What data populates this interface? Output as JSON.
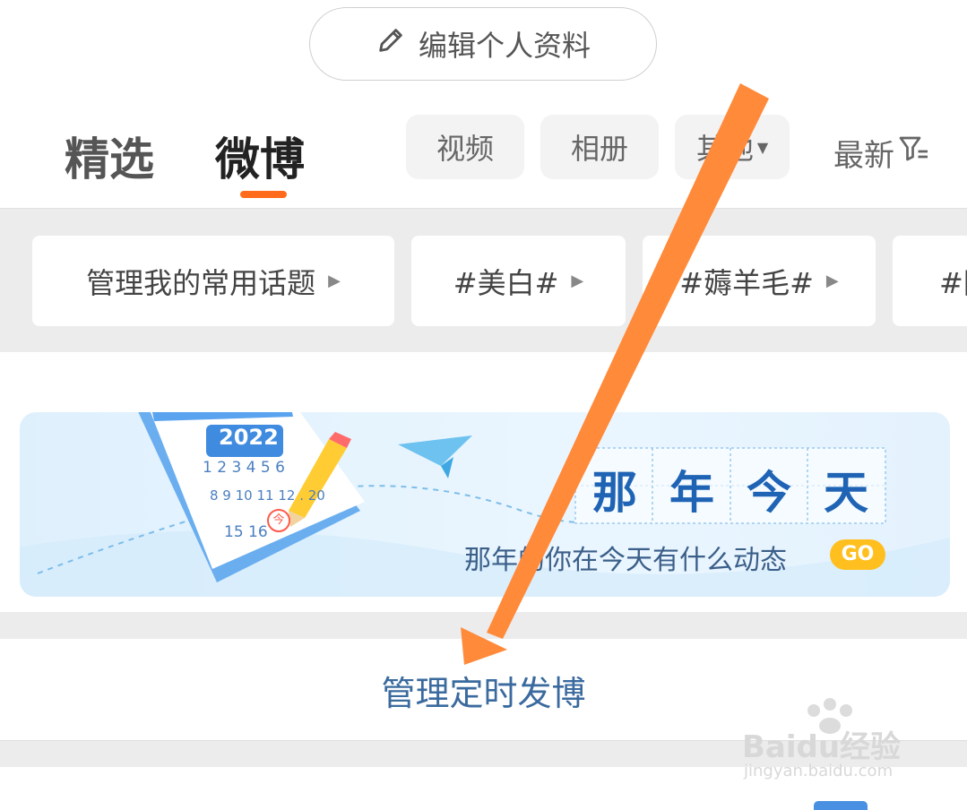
{
  "profile": {
    "edit_label": "编辑个人资料"
  },
  "tabs": {
    "featured": "精选",
    "weibo": "微博",
    "chips": [
      "视频",
      "相册",
      "其他"
    ],
    "latest": "最新"
  },
  "topics": [
    "管理我的常用话题",
    "#美白#",
    "#薅羊毛#",
    "#防"
  ],
  "banner": {
    "year": "2022",
    "cal_rows": [
      "1 2 3 4 5 6",
      "8 9 10 11 12 . 20",
      "15 16"
    ],
    "today_char": "今",
    "title_chars": [
      "那",
      "年",
      "今",
      "天"
    ],
    "subtitle": "那年的你在今天有什么动态",
    "go_label": "GO"
  },
  "manage_scheduled": "管理定时发博",
  "watermark": {
    "brand": "Baidu经验",
    "url": "jingyan.baidu.com"
  },
  "colors": {
    "accent_orange": "#ff6b1a",
    "arrow": "#ff8a3a",
    "link_blue": "#3a6a9e",
    "go_yellow": "#ffbf1f",
    "banner_title": "#1f63b5"
  }
}
